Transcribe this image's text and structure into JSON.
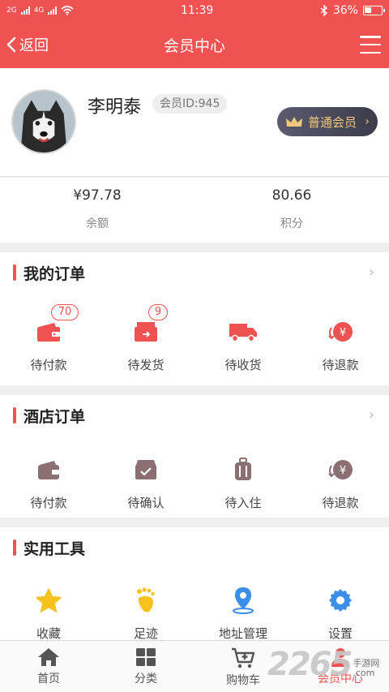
{
  "status_bar": {
    "time": "11:39",
    "signal1": "2G",
    "signal2": "4G",
    "battery": "36%"
  },
  "nav": {
    "back_label": "返回",
    "title": "会员中心",
    "menu_icon": "hamburger-menu-icon"
  },
  "profile": {
    "name": "李明泰",
    "member_id": "会员ID:945",
    "level": "普通会员"
  },
  "balance": {
    "items": [
      {
        "value": "¥97.78",
        "label": "余额"
      },
      {
        "value": "80.66",
        "label": "积分"
      }
    ]
  },
  "my_orders": {
    "title": "我的订单",
    "items": [
      {
        "label": "待付款",
        "badge": "70",
        "icon": "wallet-icon"
      },
      {
        "label": "待发货",
        "badge": "9",
        "icon": "outbox-icon"
      },
      {
        "label": "待收货",
        "badge": "",
        "icon": "truck-icon"
      },
      {
        "label": "待退款",
        "badge": "",
        "icon": "refund-icon"
      }
    ]
  },
  "hotel_orders": {
    "title": "酒店订单",
    "items": [
      {
        "label": "待付款",
        "icon": "wallet-icon"
      },
      {
        "label": "待确认",
        "icon": "check-box-icon"
      },
      {
        "label": "待入住",
        "icon": "luggage-icon"
      },
      {
        "label": "待退款",
        "icon": "refund-icon"
      }
    ]
  },
  "tools": {
    "title": "实用工具",
    "items": [
      {
        "label": "收藏",
        "icon": "star-icon"
      },
      {
        "label": "足迹",
        "icon": "footprint-icon"
      },
      {
        "label": "地址管理",
        "icon": "location-icon"
      },
      {
        "label": "设置",
        "icon": "gear-icon"
      }
    ]
  },
  "tabbar": {
    "items": [
      {
        "label": "首页",
        "icon": "home-icon"
      },
      {
        "label": "分类",
        "icon": "category-grid-icon"
      },
      {
        "label": "购物车",
        "icon": "cart-icon"
      },
      {
        "label": "会员中心",
        "icon": "user-icon"
      }
    ]
  },
  "watermark": {
    "number": "2265",
    "site": "手游网",
    "domain": ".com"
  },
  "colors": {
    "accent": "#f05151",
    "badge_gold": "#f1c77a",
    "hotel_icon": "#8b6f73",
    "star": "#f7c21c",
    "location": "#3b8fe8"
  }
}
